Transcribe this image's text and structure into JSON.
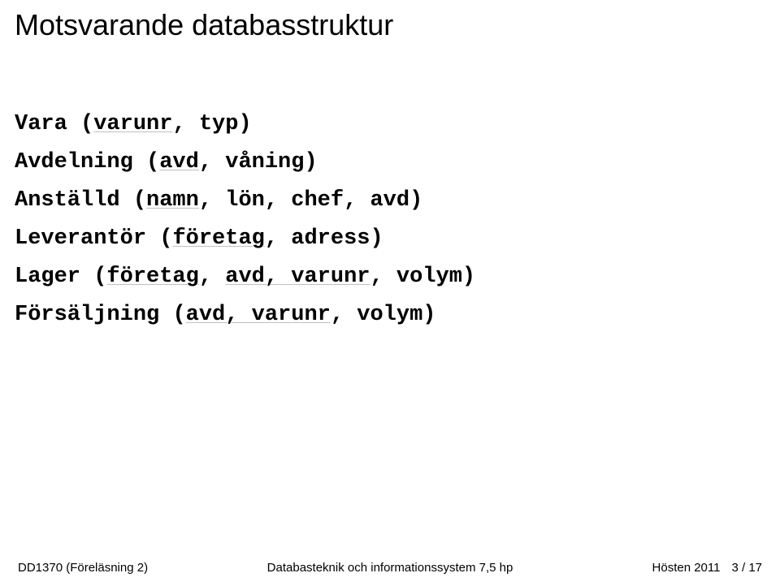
{
  "title": "Motsvarande databasstruktur",
  "schema": [
    {
      "name": "Vara",
      "parts": [
        {
          "t": "varunr",
          "u": true
        },
        {
          "t": ", ",
          "u": false
        },
        {
          "t": "typ)",
          "u": false
        }
      ]
    },
    {
      "name": "Avdelning",
      "parts": [
        {
          "t": "avd",
          "u": true
        },
        {
          "t": ", ",
          "u": false
        },
        {
          "t": "våning)",
          "u": false
        }
      ]
    },
    {
      "name": "Anställd",
      "parts": [
        {
          "t": "namn",
          "u": true
        },
        {
          "t": ", ",
          "u": false
        },
        {
          "t": "lön, chef, avd)",
          "u": false
        }
      ]
    },
    {
      "name": "Leverantör",
      "parts": [
        {
          "t": "företag",
          "u": true
        },
        {
          "t": ", ",
          "u": false
        },
        {
          "t": "adress)",
          "u": false
        }
      ]
    },
    {
      "name": "Lager",
      "parts": [
        {
          "t": "företag",
          "u": true
        },
        {
          "t": ", ",
          "u": false
        },
        {
          "t": "avd, varunr",
          "u": true
        },
        {
          "t": ", ",
          "u": false
        },
        {
          "t": "volym)",
          "u": false
        }
      ]
    },
    {
      "name": "Försäljning",
      "parts": [
        {
          "t": "avd, varunr",
          "u": true
        },
        {
          "t": ", ",
          "u": false
        },
        {
          "t": "volym)",
          "u": false
        }
      ]
    }
  ],
  "footer": {
    "left": "DD1370 (Föreläsning 2)",
    "center": "Databasteknik och informationssystem 7,5 hp",
    "right_term": "Hösten 2011",
    "right_page": "3 / 17"
  },
  "open_paren": "("
}
